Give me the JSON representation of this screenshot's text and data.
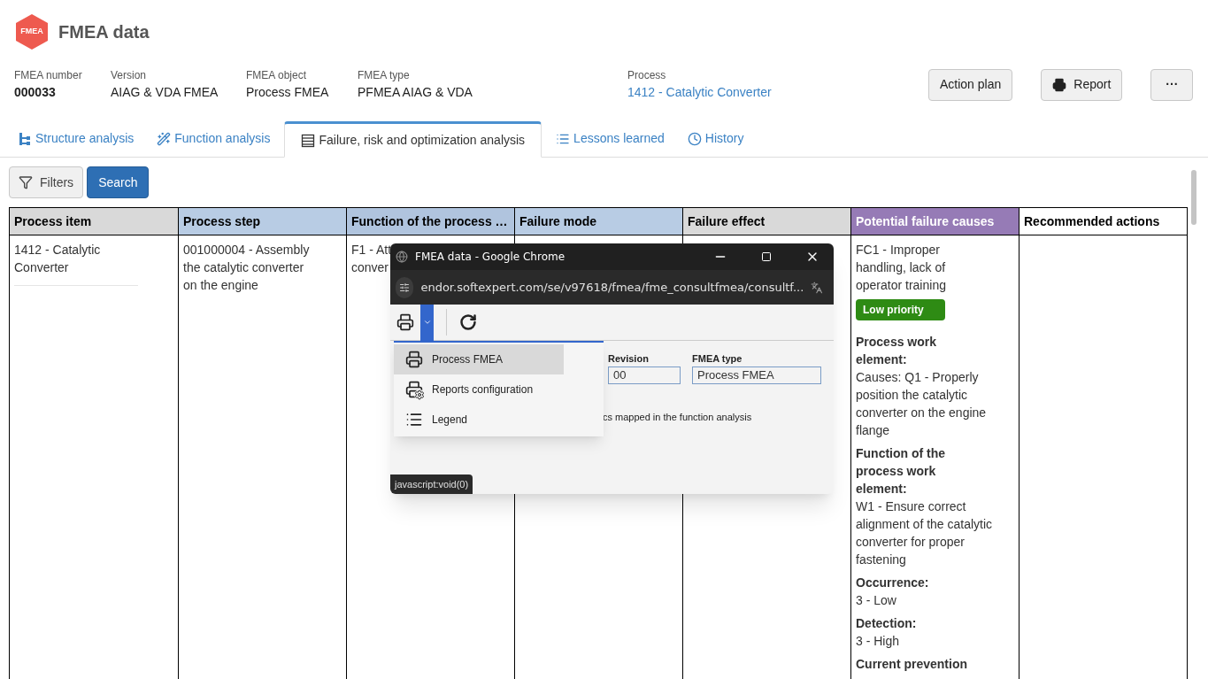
{
  "app": {
    "title": "FMEA data",
    "logo_text": "FMEA"
  },
  "meta": [
    {
      "label": "FMEA number",
      "value": "000033",
      "kind": "bold"
    },
    {
      "label": "Version",
      "value": "AIAG & VDA FMEA",
      "kind": "plain"
    },
    {
      "label": "FMEA object",
      "value": "Process FMEA",
      "kind": "plain"
    },
    {
      "label": "FMEA type",
      "value": "PFMEA AIAG & VDA",
      "kind": "plain"
    },
    {
      "label": "Process",
      "value": "1412 - Catalytic Converter",
      "kind": "link"
    }
  ],
  "actions": [
    {
      "label": "Action plan",
      "kind": "text"
    },
    {
      "label": "Report",
      "kind": "print"
    },
    {
      "label": "···",
      "kind": "more"
    }
  ],
  "tabs": [
    {
      "label": "Structure analysis",
      "kind": "structure",
      "selected": false
    },
    {
      "label": "Function analysis",
      "kind": "wand",
      "selected": false
    },
    {
      "label": "Failure, risk and optimization analysis",
      "kind": "table",
      "selected": true
    },
    {
      "label": "Lessons learned",
      "kind": "list",
      "selected": false
    },
    {
      "label": "History",
      "kind": "clock",
      "selected": false
    }
  ],
  "toolbar": {
    "filters": "Filters",
    "search": "Search"
  },
  "table": {
    "columns": [
      {
        "label": "Process item",
        "color": "#d9d9d9"
      },
      {
        "label": "Process step",
        "color": "#b8cce4"
      },
      {
        "label": "Function of the process …",
        "color": "#b0c4de"
      },
      {
        "label": "Failure mode",
        "color": "#b8cce4"
      },
      {
        "label": "Failure effect",
        "color": "#d9d9d9"
      },
      {
        "label": "Potential failure causes",
        "color": "#967bb6"
      },
      {
        "label": "Recommended actions",
        "color": "#ffffff"
      }
    ],
    "row": {
      "process_item": "1412 - Catalytic Converter",
      "process_step": "001000004 - Assembly the catalytic converter on the engine",
      "function_lines": [
        "F1 - Att",
        "conver"
      ],
      "cause": "FC1 - Improper handling, lack of operator training",
      "priority": "Low priority",
      "details": [
        {
          "label": "Process work element:",
          "value": "Causes: Q1 - Properly position the catalytic converter on the engine flange"
        },
        {
          "label": "Function of the process work element:",
          "value": "W1 - Ensure correct alignment of the catalytic converter for proper fastening"
        },
        {
          "label": "Occurrence:",
          "value": "3 - Low"
        },
        {
          "label": "Detection:",
          "value": "3 - High"
        },
        {
          "label": "Current prevention"
        }
      ]
    }
  },
  "popup": {
    "title": "FMEA data - Google Chrome",
    "url": "endor.softexpert.com/se/v97618/fmea/fme_consultfmea/consultf...",
    "menu": [
      {
        "label": "Process FMEA",
        "kind": "print",
        "selected": true
      },
      {
        "label": "Reports configuration",
        "kind": "config",
        "selected": false
      },
      {
        "label": "Legend",
        "kind": "legend",
        "selected": false
      }
    ],
    "fields": [
      {
        "label": "Revision",
        "value": "00"
      },
      {
        "label": "FMEA type",
        "value": "Process FMEA"
      }
    ],
    "partial_text": "cs mapped in the function analysis",
    "status": "javascript:void(0)"
  }
}
